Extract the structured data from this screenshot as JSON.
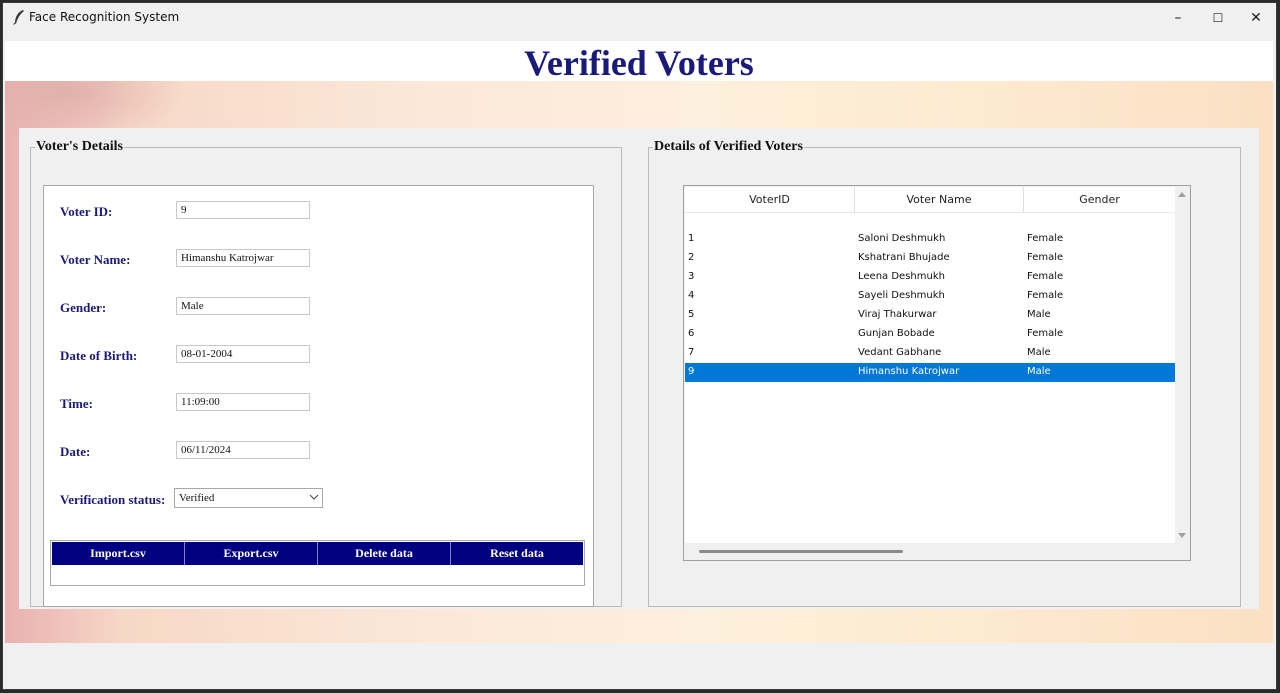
{
  "window": {
    "title": "Face Recognition System",
    "controls": {
      "minimize": "–",
      "maximize": "☐",
      "close": "✕"
    }
  },
  "banner": {
    "title": "Verified Voters"
  },
  "details_panel": {
    "title": "Voter's Details",
    "fields": {
      "voter_id": {
        "label": "Voter ID:",
        "value": "9"
      },
      "voter_name": {
        "label": "Voter Name:",
        "value": "Himanshu Katrojwar"
      },
      "gender": {
        "label": "Gender:",
        "value": "Male"
      },
      "dob": {
        "label": "Date of Birth:",
        "value": "08-01-2004"
      },
      "time": {
        "label": "Time:",
        "value": "11:09:00"
      },
      "date": {
        "label": "Date:",
        "value": "06/11/2024"
      },
      "status": {
        "label": "Verification status:",
        "value": "Verified"
      }
    },
    "buttons": {
      "import": "Import.csv",
      "export": "Export.csv",
      "delete": "Delete data",
      "reset": "Reset data"
    }
  },
  "table_panel": {
    "title": "Details of Verified Voters",
    "columns": [
      "VoterID",
      "Voter Name",
      "Gender"
    ],
    "rows": [
      {
        "id": "1",
        "name": "Saloni Deshmukh",
        "gender": "Female"
      },
      {
        "id": "2",
        "name": "Kshatrani Bhujade",
        "gender": "Female"
      },
      {
        "id": "3",
        "name": "Leena Deshmukh",
        "gender": "Female"
      },
      {
        "id": "4",
        "name": "Sayeli Deshmukh",
        "gender": "Female"
      },
      {
        "id": "5",
        "name": "Viraj Thakurwar",
        "gender": "Male"
      },
      {
        "id": "6",
        "name": "Gunjan Bobade",
        "gender": "Female"
      },
      {
        "id": "7",
        "name": "Vedant Gabhane",
        "gender": "Male"
      },
      {
        "id": "9",
        "name": "Himanshu Katrojwar",
        "gender": "Male"
      }
    ],
    "selected_row": 7
  },
  "colors": {
    "banner_text": "#1a1a7a",
    "button_bar": "#000080",
    "selection": "#0078d7"
  }
}
